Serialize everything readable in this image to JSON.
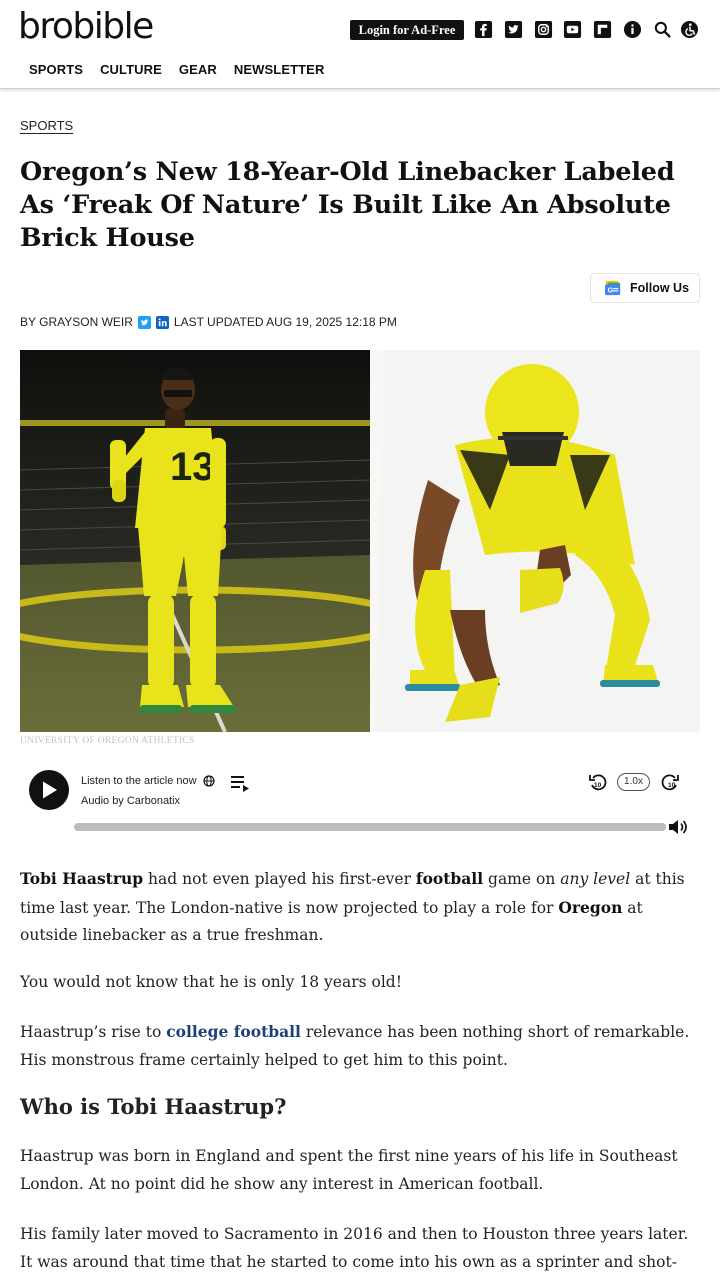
{
  "header": {
    "logo": "brobible",
    "login_label": "Login for Ad-Free",
    "icons": [
      "facebook-icon",
      "twitter-icon",
      "instagram-icon",
      "youtube-icon",
      "flipboard-icon",
      "info-icon",
      "search-icon",
      "accessibility-icon"
    ],
    "nav": [
      "SPORTS",
      "CULTURE",
      "GEAR",
      "NEWSLETTER"
    ]
  },
  "article": {
    "category": "SPORTS",
    "title": "Oregon’s New 18-Year-Old Linebacker Labeled As ‘Freak Of Nature’ Is Built Like An Absolute Brick House",
    "follow_label": "Follow Us",
    "byline_author": "BY GRAYSON WEIR",
    "byline_updated": "LAST UPDATED AUG 19, 2025 12:18 PM",
    "image_credit": "UNIVERSITY OF OREGON ATHLETICS",
    "jersey_number": "13"
  },
  "audio": {
    "listen_label": "Listen to the article now",
    "audio_by": "Audio by Carbonatix",
    "speed": "1.0x",
    "progress_pct": 0
  },
  "body": {
    "p1": {
      "s1": "Tobi Haastrup",
      "s2": " had not even played his first-ever ",
      "s3": "football",
      "s4": " game on ",
      "s5": "any level",
      "s6": " at this time last year. The London-native is now projected to play a role for ",
      "s7": "Oregon",
      "s8": " at outside linebacker as a true freshman."
    },
    "p2": "You would not know that he is only 18 years old!",
    "p3": {
      "s1": "Haastrup’s rise to ",
      "link": "college football",
      "s2": " relevance has been nothing short of remarkable. His monstrous frame certainly helped to get him to this point."
    },
    "h2": "Who is Tobi Haastrup?",
    "p4": "Haastrup was born in England and spent the first nine years of his life in Southeast London. At no point did he show any interest in American football.",
    "p5": "His family later moved to Sacramento in 2016 and then to Houston three years later. It was around that time that he started to come into his own as a sprinter and shot-putter—"
  },
  "colors": {
    "accent_link": "#1f3f78",
    "oregon_yellow": "#f2e31a",
    "header_dark": "#111111"
  }
}
